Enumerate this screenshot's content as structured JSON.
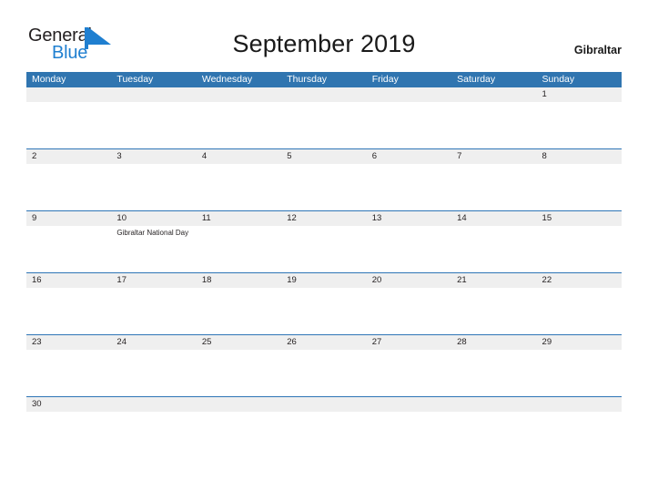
{
  "brand": {
    "name_part1": "General",
    "name_part2": "Blue",
    "flag_icon": "blue-triangle-flag-icon",
    "color_dark": "#231f20",
    "color_blue": "#1f7fd0"
  },
  "header": {
    "title": "September 2019",
    "region": "Gibraltar"
  },
  "theme": {
    "header_blue": "#3075b0",
    "row_border_blue": "#2e75b6",
    "date_band_gray": "#efefef",
    "text_dark": "#231f20",
    "page_background": "#ffffff"
  },
  "calendar": {
    "weekdays": [
      "Monday",
      "Tuesday",
      "Wednesday",
      "Thursday",
      "Friday",
      "Saturday",
      "Sunday"
    ],
    "weeks": [
      {
        "days": [
          {
            "date": "",
            "event": ""
          },
          {
            "date": "",
            "event": ""
          },
          {
            "date": "",
            "event": ""
          },
          {
            "date": "",
            "event": ""
          },
          {
            "date": "",
            "event": ""
          },
          {
            "date": "",
            "event": ""
          },
          {
            "date": "1",
            "event": ""
          }
        ]
      },
      {
        "days": [
          {
            "date": "2",
            "event": ""
          },
          {
            "date": "3",
            "event": ""
          },
          {
            "date": "4",
            "event": ""
          },
          {
            "date": "5",
            "event": ""
          },
          {
            "date": "6",
            "event": ""
          },
          {
            "date": "7",
            "event": ""
          },
          {
            "date": "8",
            "event": ""
          }
        ]
      },
      {
        "days": [
          {
            "date": "9",
            "event": ""
          },
          {
            "date": "10",
            "event": "Gibraltar National Day"
          },
          {
            "date": "11",
            "event": ""
          },
          {
            "date": "12",
            "event": ""
          },
          {
            "date": "13",
            "event": ""
          },
          {
            "date": "14",
            "event": ""
          },
          {
            "date": "15",
            "event": ""
          }
        ]
      },
      {
        "days": [
          {
            "date": "16",
            "event": ""
          },
          {
            "date": "17",
            "event": ""
          },
          {
            "date": "18",
            "event": ""
          },
          {
            "date": "19",
            "event": ""
          },
          {
            "date": "20",
            "event": ""
          },
          {
            "date": "21",
            "event": ""
          },
          {
            "date": "22",
            "event": ""
          }
        ]
      },
      {
        "days": [
          {
            "date": "23",
            "event": ""
          },
          {
            "date": "24",
            "event": ""
          },
          {
            "date": "25",
            "event": ""
          },
          {
            "date": "26",
            "event": ""
          },
          {
            "date": "27",
            "event": ""
          },
          {
            "date": "28",
            "event": ""
          },
          {
            "date": "29",
            "event": ""
          }
        ]
      },
      {
        "days": [
          {
            "date": "30",
            "event": ""
          },
          {
            "date": "",
            "event": ""
          },
          {
            "date": "",
            "event": ""
          },
          {
            "date": "",
            "event": ""
          },
          {
            "date": "",
            "event": ""
          },
          {
            "date": "",
            "event": ""
          },
          {
            "date": "",
            "event": ""
          }
        ]
      }
    ]
  }
}
